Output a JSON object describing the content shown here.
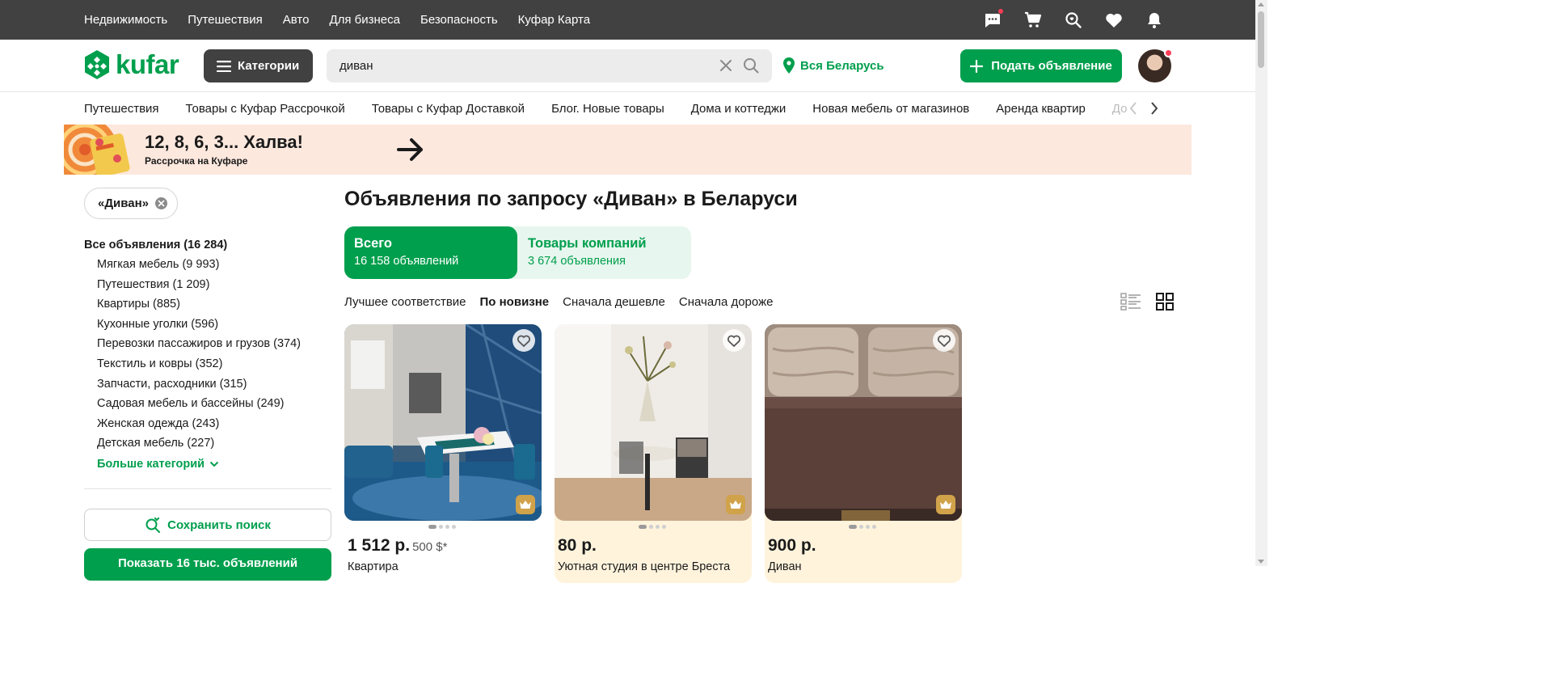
{
  "top_nav": [
    "Недвижимость",
    "Путешествия",
    "Авто",
    "Для бизнеса",
    "Безопасность",
    "Куфар Карта"
  ],
  "top_icons": [
    "chat-icon",
    "cart-icon",
    "search-heart-icon",
    "heart-icon",
    "bell-icon"
  ],
  "header": {
    "logo_text": "kufar",
    "categories_label": "Категории",
    "search_value": "диван",
    "region_label": "Вся Беларусь",
    "post_label": "Подать объявление"
  },
  "category_strip": [
    "Путешествия",
    "Товары с Куфар Рассрочкой",
    "Товары с Куфар Доставкой",
    "Блог. Новые товары",
    "Дома и коттеджи",
    "Новая мебель от магазинов",
    "Аренда квартир",
    "Дома"
  ],
  "banner": {
    "title": "12, 8, 6, 3... Халва!",
    "subtitle": "Рассрочка на Куфаре"
  },
  "sidebar": {
    "chip_label": "«Диван»",
    "all_label": "Все объявления (16 284)",
    "categories": [
      "Мягкая мебель (9 993)",
      "Путешествия (1 209)",
      "Квартиры (885)",
      "Кухонные уголки (596)",
      "Перевозки пассажиров и грузов (374)",
      "Текстиль и ковры (352)",
      "Запчасти, расходники (315)",
      "Садовая мебель и бассейны (249)",
      "Женская одежда (243)",
      "Детская мебель (227)"
    ],
    "more_label": "Больше категорий",
    "save_search_label": "Сохранить поиск",
    "show_label": "Показать 16 тыс. объявлений"
  },
  "main": {
    "title": "Объявления по запросу «Диван» в Беларуси",
    "tabs": [
      {
        "label": "Всего",
        "count": "16 158 объявлений"
      },
      {
        "label": "Товары компаний",
        "count": "3 674 объявления"
      }
    ],
    "sort_options": [
      "Лучшее соответствие",
      "По новизне",
      "Сначала дешевле",
      "Сначала дороже"
    ],
    "active_sort": "По новизне"
  },
  "listings": [
    {
      "price": "1 512 р.",
      "price_alt": "500 $*",
      "title": "Квартира",
      "highlighted": false
    },
    {
      "price": "80 р.",
      "price_alt": "",
      "title": "Уютная студия в центре Бреста",
      "highlighted": true
    },
    {
      "price": "900 р.",
      "price_alt": "",
      "title": "Диван",
      "highlighted": true
    }
  ],
  "colors": {
    "accent": "#009f4d",
    "topbar": "#414141",
    "badge": "#ff3d57",
    "highlight": "#fff3dc",
    "banner": "#fde8de"
  }
}
